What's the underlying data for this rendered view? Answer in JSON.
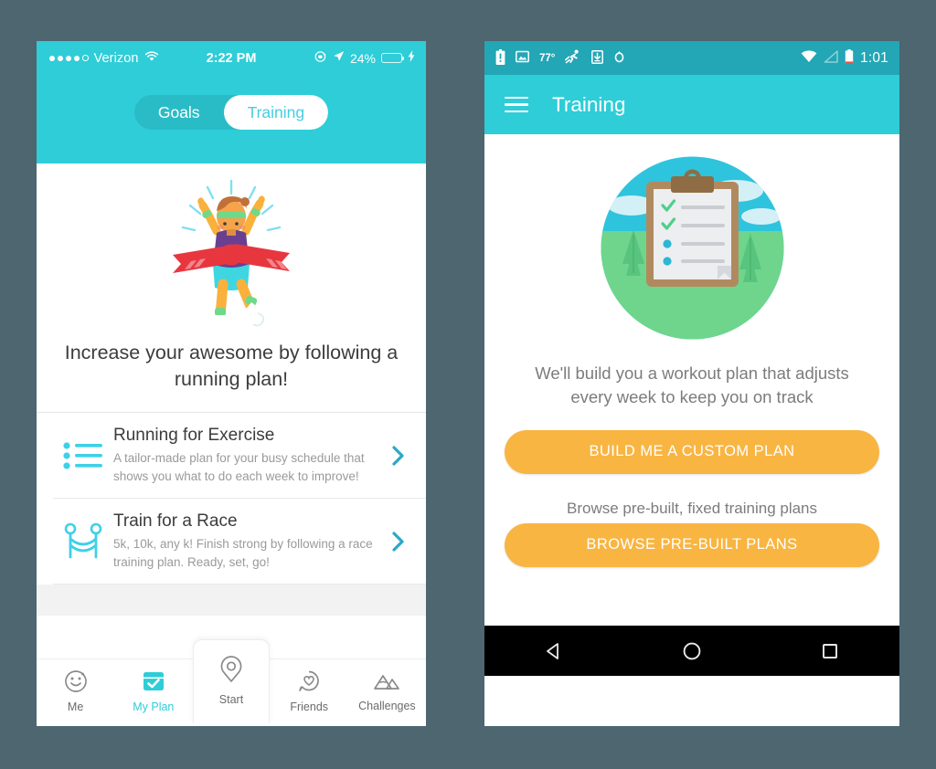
{
  "page": {
    "background_color": "#4d6670",
    "accent_teal": "#2ecdd7",
    "accent_orange": "#f9b542"
  },
  "ios": {
    "status_bar": {
      "carrier": "Verizon",
      "time": "2:22 PM",
      "battery_percent": "24%",
      "signal_dots_filled": 4,
      "signal_dots_total": 5,
      "icons": [
        "wifi-icon",
        "rotation-lock-icon",
        "location-arrow-icon",
        "battery-icon",
        "charging-bolt-icon"
      ]
    },
    "segmented_control": {
      "options": [
        "Goals",
        "Training"
      ],
      "selected": "Training"
    },
    "hero": {
      "illustration": "runner-crossing-finish-line-illustration",
      "headline": "Increase your awesome by following a running plan!"
    },
    "list": [
      {
        "icon": "bulleted-list-icon",
        "title": "Running for Exercise",
        "subtitle": "A tailor-made plan for your busy schedule that shows you what to do each week to improve!",
        "chevron": "chevron-right-icon"
      },
      {
        "icon": "finish-line-barrier-icon",
        "title": "Train for a Race",
        "subtitle": "5k, 10k, any k! Finish strong by following a race training plan. Ready, set, go!",
        "chevron": "chevron-right-icon"
      }
    ],
    "tab_bar": {
      "items": [
        {
          "label": "Me",
          "icon": "smiley-face-icon",
          "active": false
        },
        {
          "label": "My Plan",
          "icon": "calendar-check-icon",
          "active": true
        },
        {
          "label": "Start",
          "icon": "location-pin-icon",
          "active": false,
          "raised": true
        },
        {
          "label": "Friends",
          "icon": "heart-chat-icon",
          "active": false
        },
        {
          "label": "Challenges",
          "icon": "mountains-icon",
          "active": false
        }
      ],
      "active_color": "#2ecdd7"
    }
  },
  "android": {
    "status_bar": {
      "temperature": "77°",
      "time": "1:01",
      "left_icons": [
        "battery-alert-icon",
        "image-icon",
        "temperature-label",
        "running-activity-icon",
        "download-icon",
        "circle-icon"
      ],
      "right_icons": [
        "wifi-icon",
        "cellular-signal-icon",
        "battery-icon"
      ]
    },
    "app_bar": {
      "menu_icon": "hamburger-menu-icon",
      "title": "Training"
    },
    "content": {
      "illustration": "clipboard-checklist-outdoors-illustration",
      "description": "We'll build you a workout plan that adjusts every week to keep you on track",
      "primary_button": "BUILD ME A CUSTOM PLAN",
      "subtext": "Browse pre-built, fixed training plans",
      "secondary_button": "BROWSE PRE-BUILT PLANS"
    },
    "nav_bar": {
      "back": "back-triangle-icon",
      "home": "home-circle-icon",
      "recents": "recents-square-icon"
    }
  }
}
